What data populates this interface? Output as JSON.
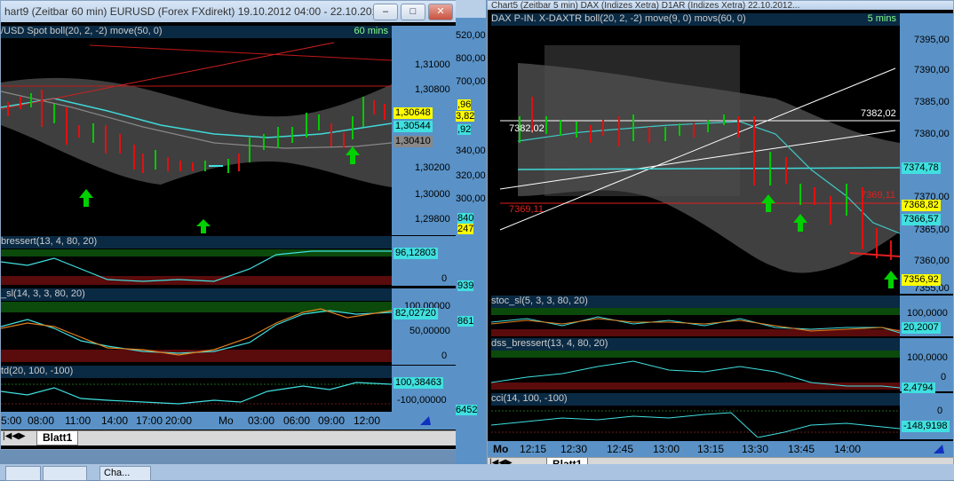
{
  "left_window": {
    "title": "hart9 (Zeitbar 60 min)  EURUSD (Forex FXdirekt) 19.10.2012 04:00 - 22.10.201...",
    "price_panel": {
      "header": "/USD Spot boll(20, 2, -2) move(50, 0)",
      "timeframe": "60 mins",
      "y_labels": [
        "1,31000",
        "1,30800",
        "1,30200",
        "1,30000",
        "1,29800"
      ],
      "value_boxes": [
        "1,30648",
        "1,30544",
        "1,30410"
      ]
    },
    "dss_panel": {
      "header": "bressert(13, 4, 80, 20)",
      "value": "96,12803",
      "y_labels": [
        "0"
      ]
    },
    "stoc_panel": {
      "header": "_sl(14, 3, 3, 80, 20)",
      "value": "82,02720",
      "y_labels": [
        "100,00000",
        "50,00000",
        "0"
      ]
    },
    "cci_panel": {
      "header": "td(20, 100, -100)",
      "value": "100,38463",
      "y_labels": [
        "-100,00000"
      ]
    },
    "x_labels": [
      "5:00",
      "08:00",
      "11:00",
      "14:00",
      "17:00",
      "20:00",
      "Mo",
      "03:00",
      "06:00",
      "09:00",
      "12:00"
    ],
    "sheet_tab": "Blatt1"
  },
  "middle_strip": {
    "labels": [
      "520,00",
      "800,00",
      "700,00",
      ",96",
      "3,82",
      ",92",
      "340,00",
      "320,00",
      "300,00",
      "840",
      "247",
      "939",
      "861",
      "6452"
    ]
  },
  "right_window": {
    "title": "Chart5 (Zeitbar 5 min)  DAX (Indizes Xetra) D1AR (Indizes Xetra) 22.10.2012...",
    "price_panel": {
      "header": "DAX P-IN.  X-DAXTR boll(20, 2, -2) move(9, 0) movs(60, 0)",
      "timeframe": "5 mins",
      "y_labels": [
        "7395,00",
        "7390,00",
        "7385,00",
        "7380,00",
        "7370,00",
        "7365,00",
        "7360,00",
        "7355,00"
      ],
      "value_boxes": [
        "7374,78",
        "7368,82",
        "7366,57",
        "7356,92"
      ],
      "line_labels": [
        "7382,02",
        "7382,02",
        "7369,11",
        "7369,11"
      ]
    },
    "stoc_panel": {
      "header": "stoc_sl(5, 3, 3, 80, 20)",
      "value": "20,2007",
      "y_labels": [
        "100,0000",
        "0"
      ]
    },
    "dss_panel": {
      "header": "dss_bressert(13, 4, 80, 20)",
      "value": "2,4794",
      "y_labels": [
        "100,0000",
        "0"
      ]
    },
    "cci_panel": {
      "header": "cci(14, 100, -100)",
      "value": "-148,9198",
      "y_labels": [
        "0"
      ]
    },
    "x_labels": [
      "Mo",
      "12:15",
      "12:30",
      "12:45",
      "13:00",
      "13:15",
      "13:30",
      "13:45",
      "14:00"
    ],
    "sheet_tab": "Blatt1"
  },
  "taskbar": {
    "items": [
      "Cha..."
    ]
  },
  "colors": {
    "bull": "#00c800",
    "bear": "#e01010",
    "band": "#5a5a5a",
    "axis": "#5a92c7",
    "value_yellow": "#ffff00",
    "value_cyan": "#40e0e0"
  }
}
